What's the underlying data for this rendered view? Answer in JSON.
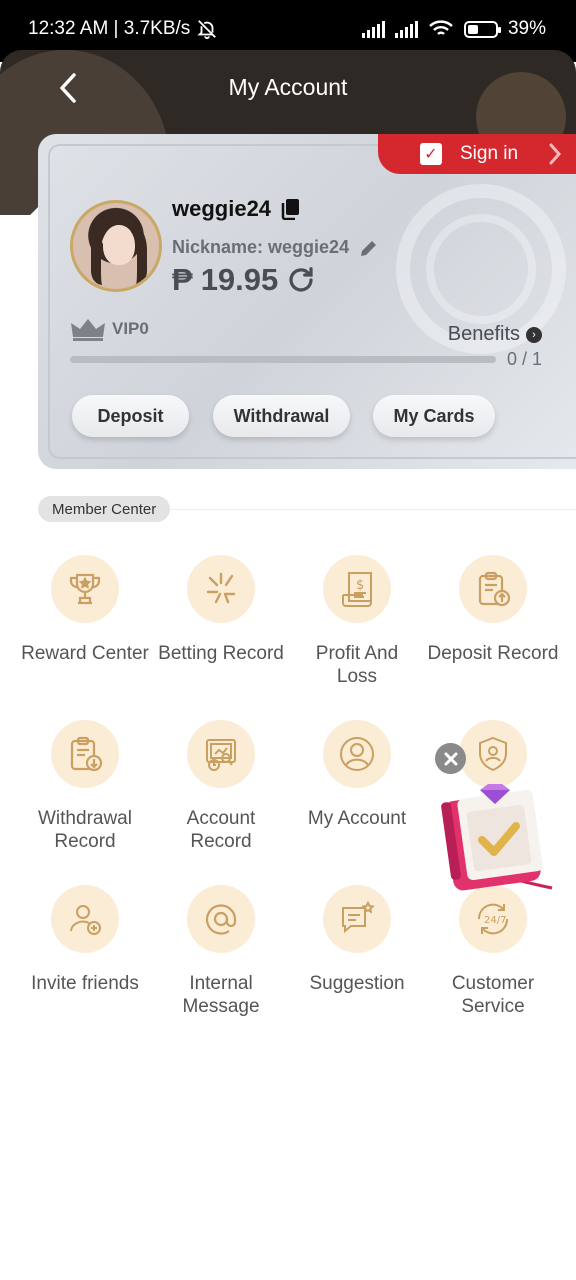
{
  "status_bar": {
    "time": "12:32 AM | 3.7KB/s",
    "battery": "39%"
  },
  "header": {
    "title": "My Account"
  },
  "account": {
    "signin_label": "Sign in",
    "username": "weggie24",
    "nickname": "Nickname: weggie24",
    "currency": "₱",
    "balance": "19.95",
    "vip_level": "VIP0",
    "benefits_label": "Benefits",
    "progress": {
      "text": "0 / 1",
      "value": 0
    },
    "buttons": {
      "deposit": "Deposit",
      "withdrawal": "Withdrawal",
      "my_cards": "My Cards"
    }
  },
  "member_center": {
    "title": "Member Center",
    "items": [
      {
        "label": "Reward Center",
        "icon": "trophy-icon"
      },
      {
        "label": "Betting Record",
        "icon": "betting-icon"
      },
      {
        "label": "Profit And Loss",
        "icon": "receipt-icon"
      },
      {
        "label": "Deposit Record",
        "icon": "deposit-clipboard-icon"
      },
      {
        "label": "Withdrawal Record",
        "icon": "withdraw-clipboard-icon"
      },
      {
        "label": "Account Record",
        "icon": "account-record-icon"
      },
      {
        "label": "My Account",
        "icon": "user-icon"
      },
      {
        "label": "",
        "icon": "shield-user-icon"
      },
      {
        "label": "Invite friends",
        "icon": "invite-user-icon"
      },
      {
        "label": "Internal Message",
        "icon": "at-icon"
      },
      {
        "label": "Suggestion",
        "icon": "suggestion-icon"
      },
      {
        "label": "Customer Service",
        "icon": "service-24-7-icon"
      }
    ]
  },
  "colors": {
    "accent_red": "#d4282e",
    "icon_bg": "#fbecd6",
    "icon_gold": "#c9a062",
    "header_bg": "#2f2925"
  }
}
